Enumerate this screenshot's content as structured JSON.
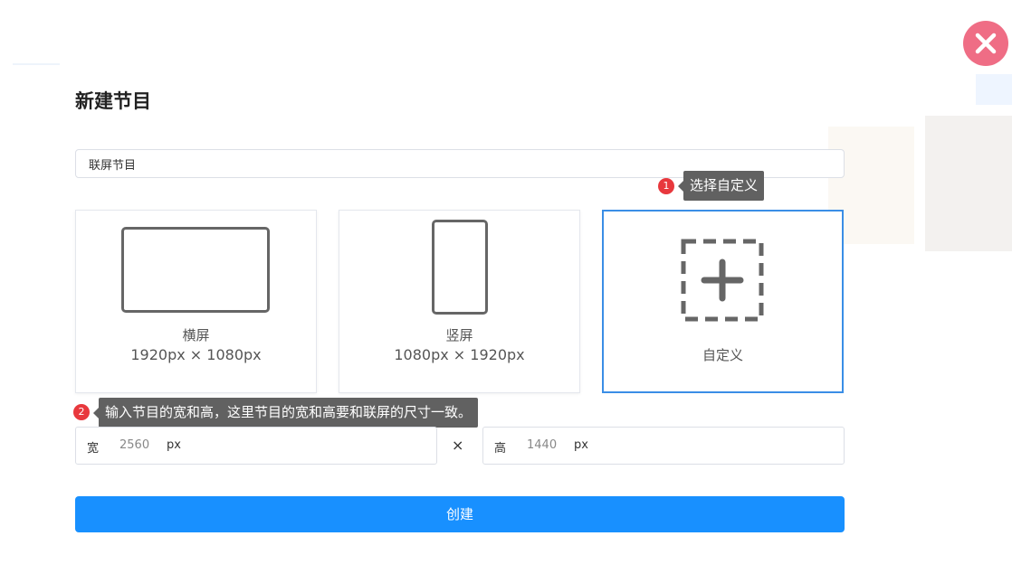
{
  "dialog": {
    "title": "新建节目",
    "name_value": "联屏节目",
    "cards": [
      {
        "label": "横屏",
        "size": "1920px × 1080px"
      },
      {
        "label": "竖屏",
        "size": "1080px × 1920px"
      },
      {
        "label": "自定义"
      }
    ],
    "selected_card": "自定义",
    "width_label": "宽",
    "width_value": "2560",
    "height_label": "高",
    "height_value": "1440",
    "unit": "px",
    "times": "×",
    "create_label": "创建"
  },
  "annotations": [
    {
      "number": "1",
      "text": "选择自定义"
    },
    {
      "number": "2",
      "text": "输入节目的宽和高，这里节目的宽和高要和联屏的尺寸一致。"
    }
  ],
  "colors": {
    "accent": "#1890ff",
    "selected_border": "#3a8ee6",
    "close": "#ef6d85",
    "callout": "#616161",
    "badge": "#e8383d"
  }
}
